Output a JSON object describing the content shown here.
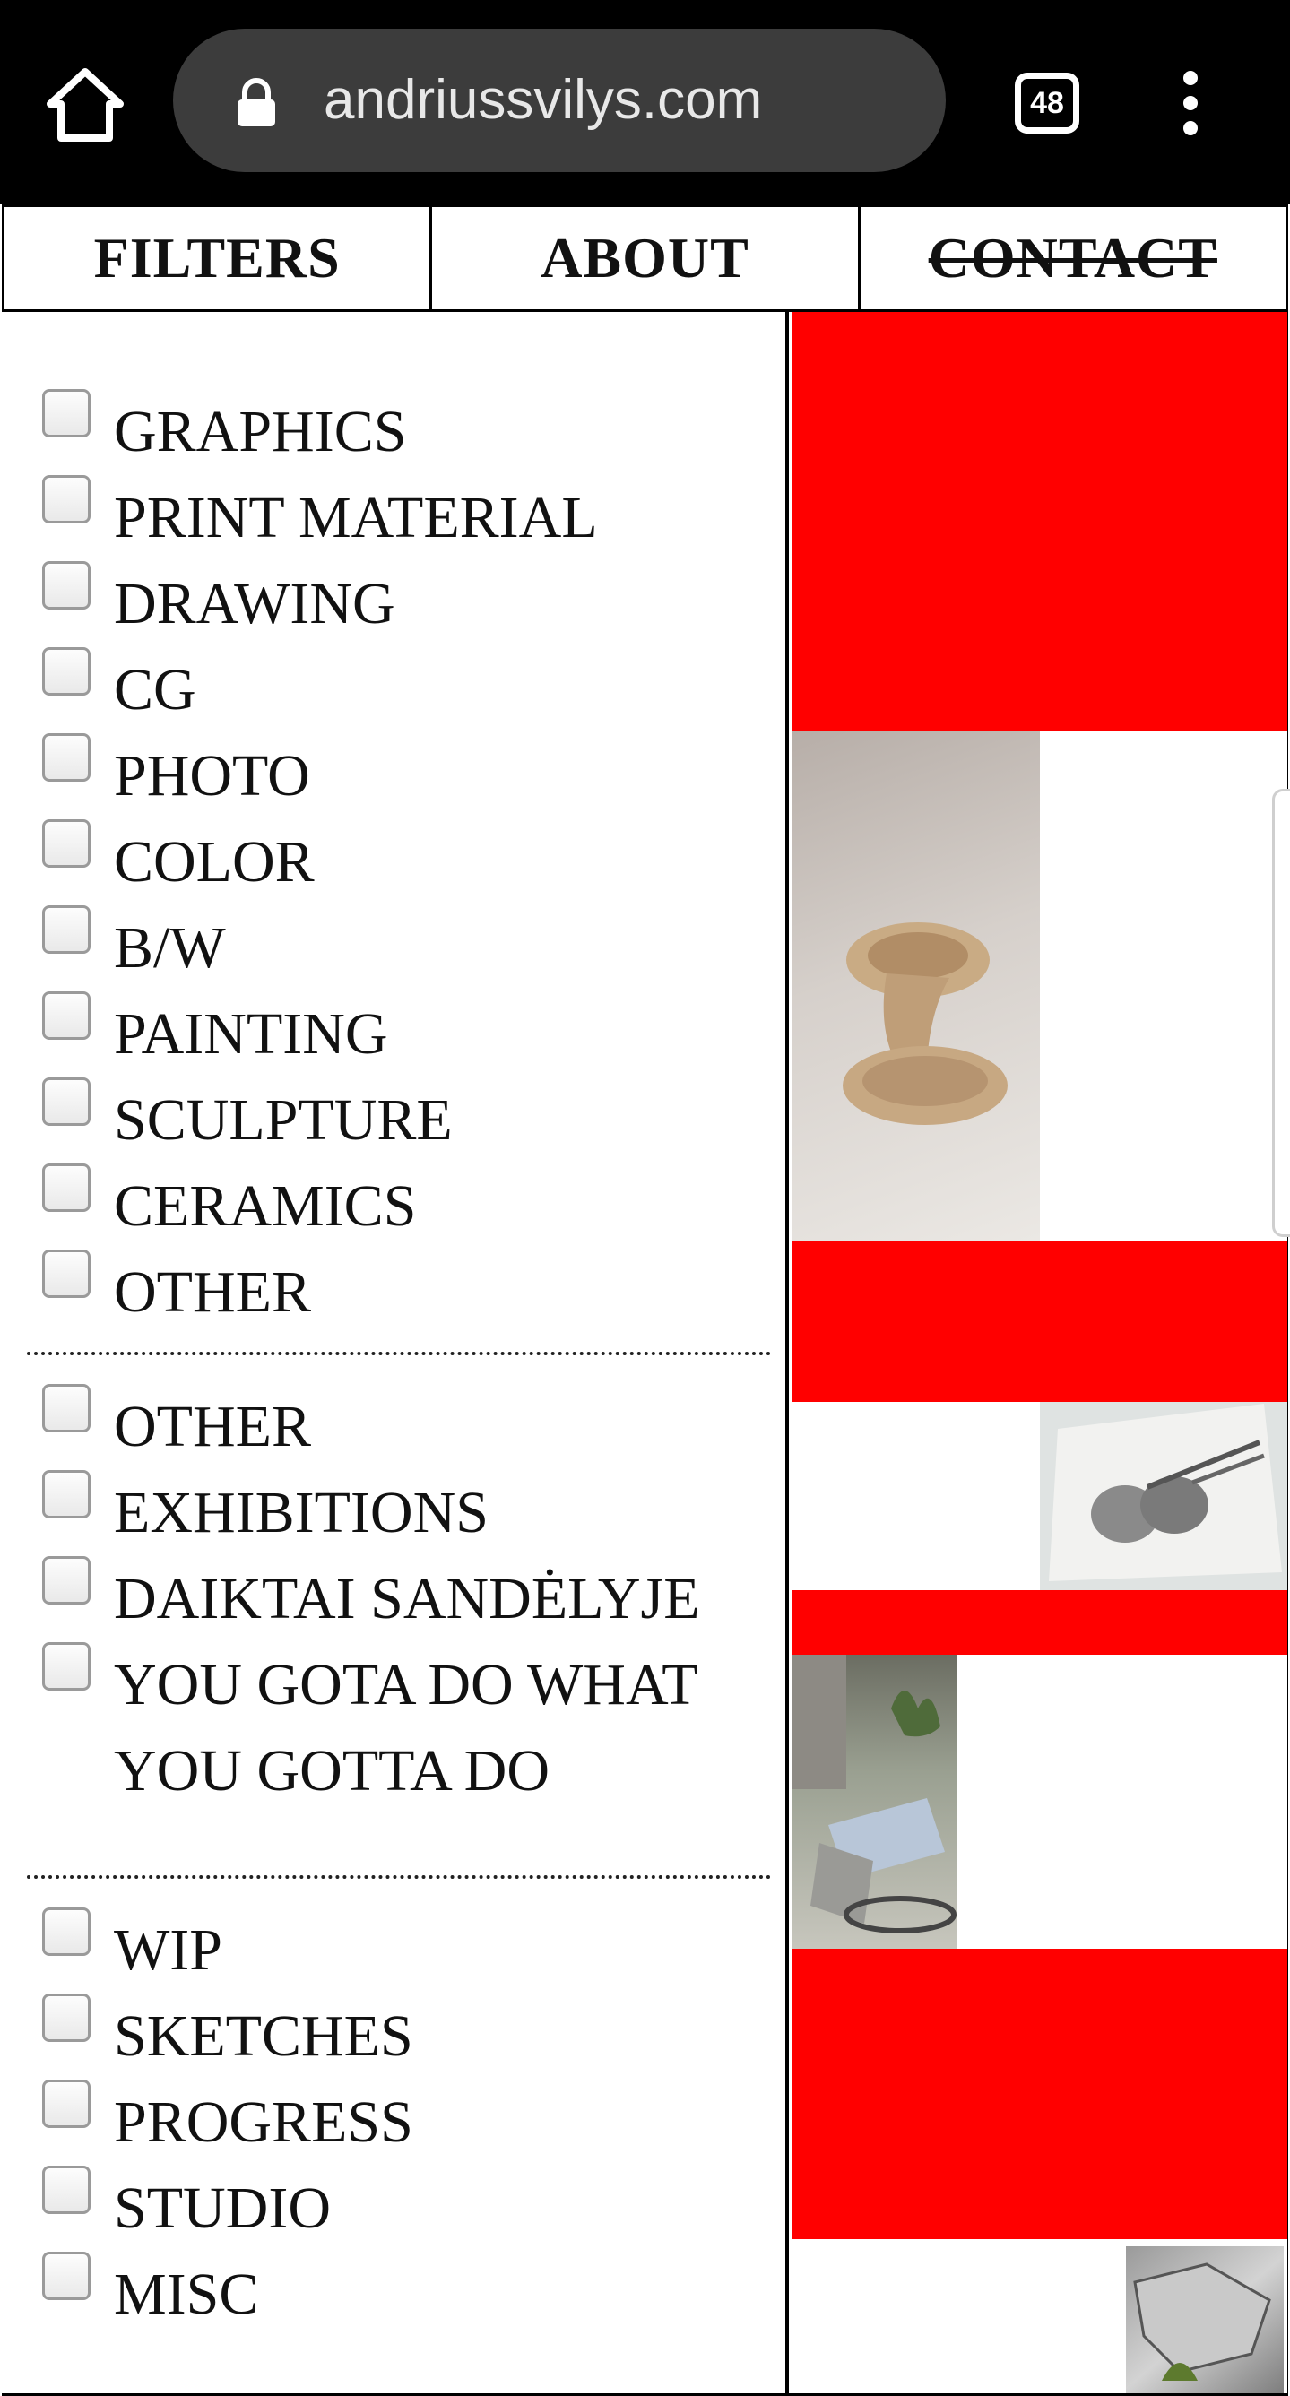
{
  "browser": {
    "url": "andriussvilys.com",
    "tab_count": "48",
    "icons": [
      "home-icon",
      "lock-icon",
      "tab-switcher-icon",
      "more-vert-icon"
    ]
  },
  "nav": {
    "filters": "FILTERS",
    "about": "ABOUT",
    "contact": "CONTACT"
  },
  "filters": {
    "group1": [
      "GRAPHICS",
      "PRINT MATERIAL",
      "DRAWING",
      "CG",
      "PHOTO",
      "COLOR",
      "B/W",
      "PAINTING",
      "SCULPTURE",
      "CERAMICS",
      "OTHER"
    ],
    "group2": [
      "OTHER",
      "EXHIBITIONS",
      "DAIKTAI SANDĖLYJE",
      "YOU GOTA DO WHAT YOU GOTTA DO"
    ],
    "group3": [
      "WIP",
      "SKETCHES",
      "PROGRESS",
      "STUDIO",
      "MISC"
    ]
  },
  "colors": {
    "accent_red": "#ff0000",
    "chrome_bg": "#000000",
    "url_pill": "#3c3c3c"
  },
  "gallery": {
    "items": [
      "ceramic-sculpture-photo",
      "pencil-drawing-photo",
      "studio-photo",
      "crumpled-paper-photo"
    ]
  }
}
